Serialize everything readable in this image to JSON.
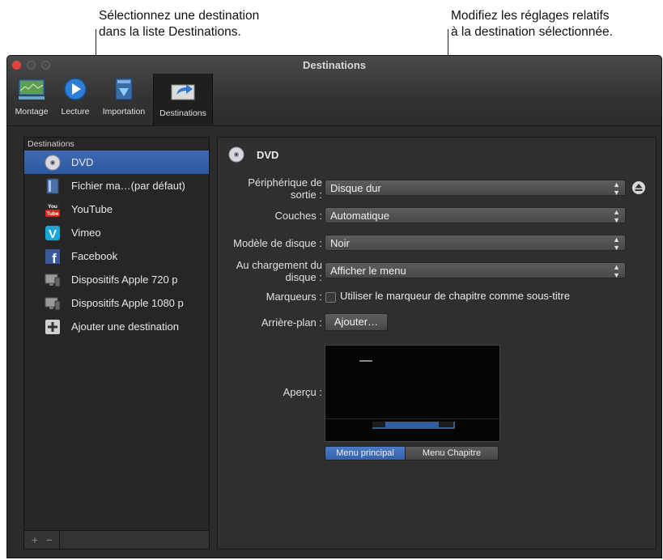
{
  "callouts": {
    "left": [
      "Sélectionnez une destination",
      "dans la liste Destinations."
    ],
    "right": [
      "Modifiez les réglages relatifs",
      "à la destination sélectionnée."
    ]
  },
  "window": {
    "title": "Destinations",
    "toolbar": [
      {
        "label": "Montage",
        "icon": "montage-icon"
      },
      {
        "label": "Lecture",
        "icon": "play-icon"
      },
      {
        "label": "Importation",
        "icon": "import-icon"
      },
      {
        "label": "Destinations",
        "icon": "share-icon",
        "selected": true
      }
    ]
  },
  "sidebar": {
    "header": "Destinations",
    "items": [
      {
        "label": "DVD",
        "icon": "dvd-icon",
        "selected": true
      },
      {
        "label": "Fichier ma…(par défaut)",
        "icon": "file-icon"
      },
      {
        "label": "YouTube",
        "icon": "youtube-icon"
      },
      {
        "label": "Vimeo",
        "icon": "vimeo-icon"
      },
      {
        "label": "Facebook",
        "icon": "facebook-icon"
      },
      {
        "label": "Dispositifs Apple 720 p",
        "icon": "apple-devices-icon"
      },
      {
        "label": "Dispositifs Apple 1080 p",
        "icon": "apple-devices-icon"
      },
      {
        "label": "Ajouter une destination",
        "icon": "add-icon"
      }
    ],
    "footer": {
      "add": "+",
      "remove": "−"
    }
  },
  "panel": {
    "title": "DVD",
    "fields": {
      "output_device": {
        "label": [
          "Périphérique de",
          "sortie :"
        ],
        "value": "Disque dur"
      },
      "layers": {
        "label": "Couches :",
        "value": "Automatique"
      },
      "disc_template": {
        "label": "Modèle de disque :",
        "value": "Noir"
      },
      "on_disc_load": {
        "label": [
          "Au chargement du",
          "disque :"
        ],
        "value": "Afficher le menu"
      },
      "markers": {
        "label": "Marqueurs :",
        "checkbox_label": "Utiliser le marqueur de chapitre comme sous-titre",
        "checked": false
      },
      "background": {
        "label": "Arrière-plan :",
        "button": "Ajouter…"
      },
      "preview": {
        "label": "Aperçu :"
      }
    },
    "preview_tabs": [
      {
        "label": "Menu principal",
        "selected": true
      },
      {
        "label": "Menu Chapitre",
        "selected": false
      }
    ]
  },
  "colors": {
    "selection": "#2e59a0",
    "window_bg": "#2b2b2b"
  }
}
